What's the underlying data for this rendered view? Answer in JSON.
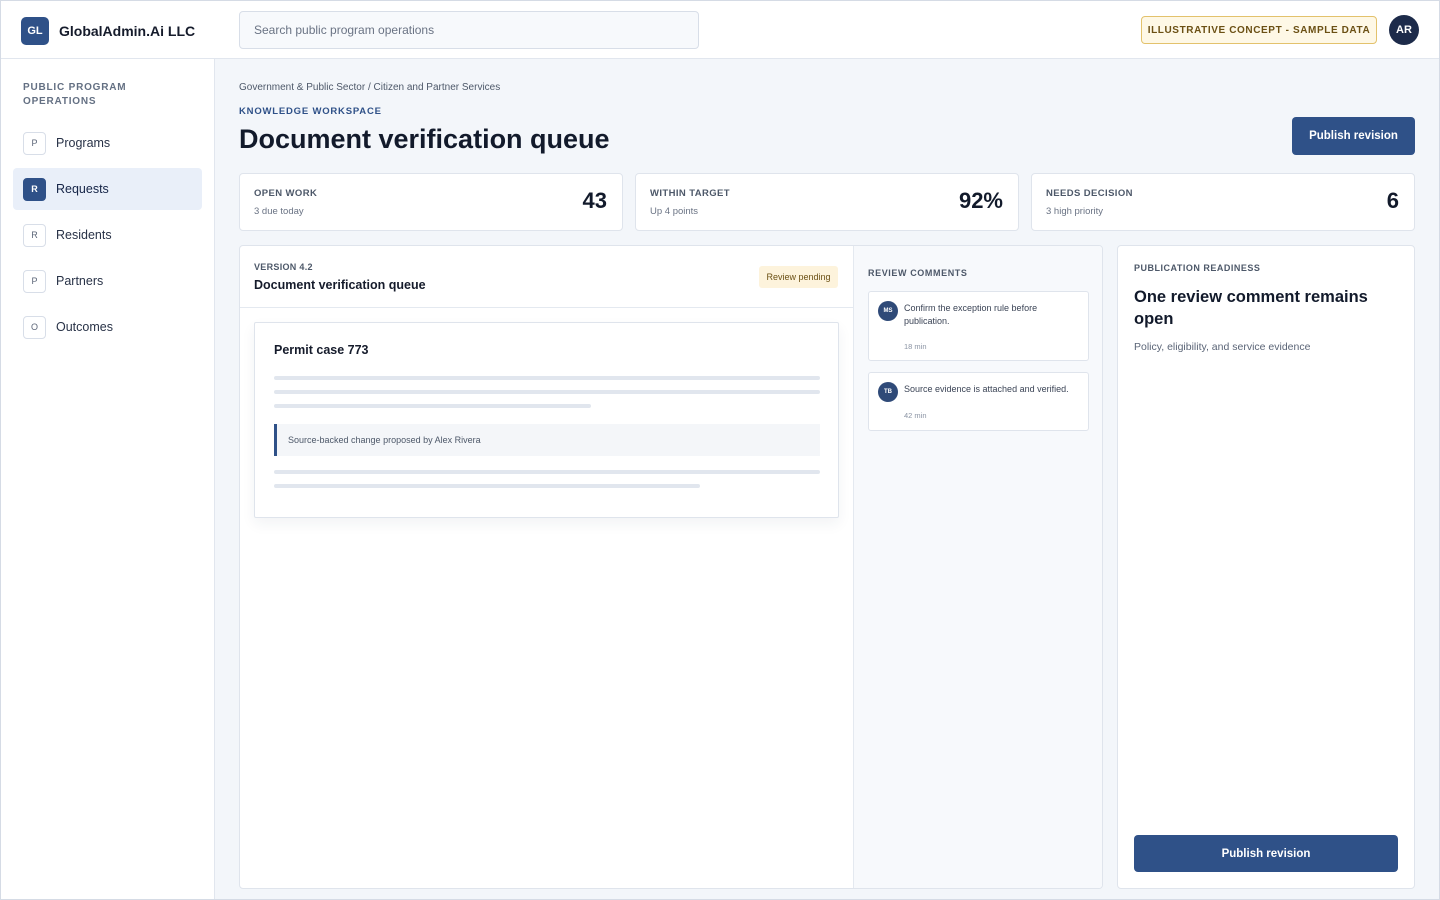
{
  "brand": {
    "logo_text": "GL",
    "name": "GlobalAdmin.Ai LLC"
  },
  "search": {
    "placeholder": "Search public program operations"
  },
  "badge": {
    "concept": "ILLUSTRATIVE CONCEPT - SAMPLE DATA"
  },
  "user": {
    "initials": "AR"
  },
  "sidebar": {
    "title": "PUBLIC PROGRAM OPERATIONS",
    "items": [
      {
        "letter": "P",
        "label": "Programs",
        "active": false
      },
      {
        "letter": "R",
        "label": "Requests",
        "active": true
      },
      {
        "letter": "R",
        "label": "Residents",
        "active": false
      },
      {
        "letter": "P",
        "label": "Partners",
        "active": false
      },
      {
        "letter": "O",
        "label": "Outcomes",
        "active": false
      }
    ]
  },
  "header": {
    "breadcrumb": "Government & Public Sector / Citizen and Partner Services",
    "eyebrow": "KNOWLEDGE WORKSPACE",
    "title": "Document verification queue",
    "publish_label": "Publish revision"
  },
  "stats": [
    {
      "label": "OPEN WORK",
      "sub": "3 due today",
      "value": "43"
    },
    {
      "label": "WITHIN TARGET",
      "sub": "Up 4 points",
      "value": "92%"
    },
    {
      "label": "NEEDS DECISION",
      "sub": "3 high priority",
      "value": "6"
    }
  ],
  "document": {
    "version": "VERSION 4.2",
    "title": "Document verification queue",
    "status": "Review pending",
    "card_title": "Permit case 773",
    "change_note": "Source-backed change proposed by Alex Rivera"
  },
  "comments": {
    "title": "REVIEW COMMENTS",
    "items": [
      {
        "initials": "MS",
        "text": "Confirm the exception rule before publication.",
        "time": "18 min"
      },
      {
        "initials": "TB",
        "text": "Source evidence is attached and verified.",
        "time": "42 min"
      }
    ]
  },
  "readiness": {
    "eyebrow": "PUBLICATION READINESS",
    "title": "One review comment remains open",
    "sub": "Policy, eligibility, and service evidence",
    "button_label": "Publish revision"
  },
  "colors": {
    "accent": "#2f5188",
    "badge_bg": "#fef8e6",
    "badge_border": "#e3c26c"
  }
}
